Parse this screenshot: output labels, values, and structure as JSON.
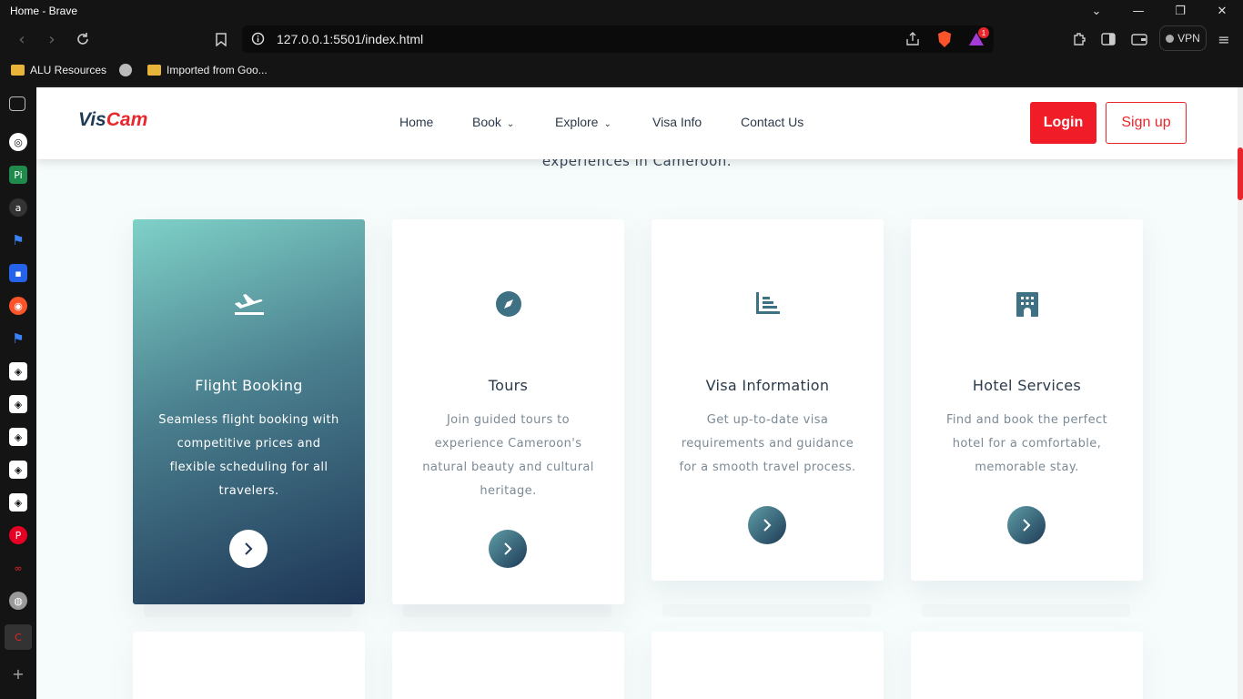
{
  "browser": {
    "window_title": "Home - Brave",
    "url": "127.0.0.1:5501/index.html",
    "vpn_label": "VPN",
    "notification_count": "1",
    "bookmarks": [
      {
        "label": "ALU Resources",
        "icon": "folder-icon"
      },
      {
        "label": "",
        "icon": "globe-icon"
      },
      {
        "label": "Imported from Goo...",
        "icon": "folder-icon"
      }
    ]
  },
  "site": {
    "logo": {
      "part1": "Vis",
      "part2": "Cam"
    },
    "nav": {
      "home": "Home",
      "book": "Book",
      "explore": "Explore",
      "visa_info": "Visa Info",
      "contact": "Contact Us"
    },
    "login": "Login",
    "signup": "Sign up",
    "subheading": "experiences in Cameroon.",
    "accent_color": "#f01c27",
    "cards": [
      {
        "title": "Flight Booking",
        "description": "Seamless flight booking with competitive prices and flexible scheduling for all travelers.",
        "icon": "plane-departure-icon"
      },
      {
        "title": "Tours",
        "description": "Join guided tours to experience Cameroon's natural beauty and cultural heritage.",
        "icon": "compass-icon"
      },
      {
        "title": "Visa Information",
        "description": "Get up-to-date visa requirements and guidance for a smooth travel process.",
        "icon": "chart-list-icon"
      },
      {
        "title": "Hotel Services",
        "description": "Find and book the perfect hotel for a comfortable, memorable stay.",
        "icon": "hotel-building-icon"
      }
    ]
  }
}
